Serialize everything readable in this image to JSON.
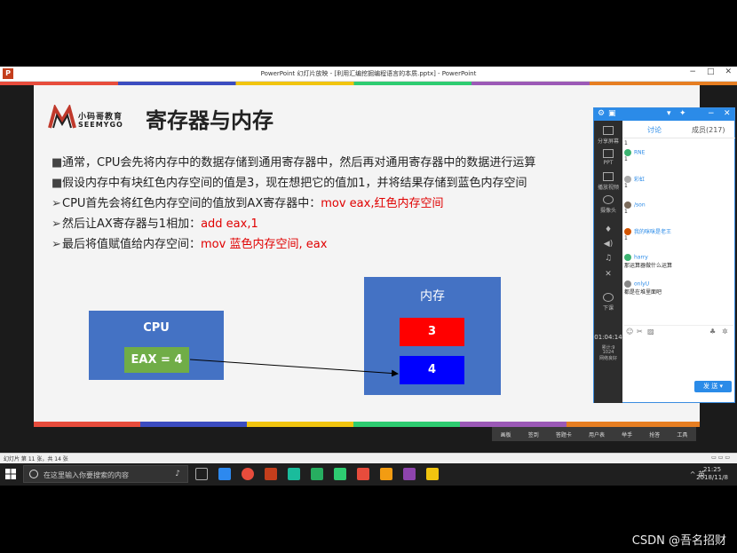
{
  "window": {
    "title": "PowerPoint 幻灯片放映 - [利用汇编挖掘编程语言的本质.pptx] - PowerPoint",
    "app_icon": "P",
    "controls": [
      "−",
      "□",
      "✕"
    ]
  },
  "slide": {
    "logo_cn": "小码哥教育",
    "logo_en": "SEEMYGO",
    "title": "寄存器与内存",
    "bullets": [
      {
        "marker": "■",
        "text": "通常，CPU会先将内存中的数据存储到通用寄存器中，然后再对通用寄存器中的数据进行运算",
        "red": ""
      },
      {
        "marker": "■",
        "text": "假设内存中有块红色内存空间的值是3，现在想把它的值加1，并将结果存储到蓝色内存空间",
        "red": ""
      },
      {
        "marker": "➢",
        "text": "CPU首先会将红色内存空间的值放到AX寄存器中：",
        "red": "mov eax,红色内存空间"
      },
      {
        "marker": "➢",
        "text": "然后让AX寄存器与1相加：",
        "red": "add eax,1"
      },
      {
        "marker": "➢",
        "text": "最后将值赋值给内存空间：",
        "red": "mov 蓝色内存空间, eax"
      }
    ],
    "cpu_label": "CPU",
    "register_label": "EAX = 4",
    "memory_label": "内存",
    "red_cell_value": "3",
    "blue_cell_value": "4",
    "colors": {
      "blue_box": "#4472c4",
      "green_reg": "#70ad47",
      "red_cell": "#ff0000",
      "blue_cell": "#0000ff"
    }
  },
  "chat_panel": {
    "tab_discuss": "讨论",
    "tab_members": "成员(217)",
    "side_items": [
      "分享屏幕",
      "PPT",
      "播放视频",
      "摄像头",
      "下课"
    ],
    "timer": "01:04:14",
    "timer_sub1": "累计:9",
    "timer_sub2": "1024",
    "timer_sub3": "网络良好",
    "messages": [
      {
        "name": "",
        "text": "1"
      },
      {
        "name": "RNE",
        "text": "1"
      },
      {
        "name": "彩虹",
        "text": "1"
      },
      {
        "name": "/son",
        "text": "1"
      },
      {
        "name": "我的咪咪是老王",
        "text": "1"
      },
      {
        "name": "harry",
        "text": "那运算器做什么运算"
      },
      {
        "name": "onlyU",
        "text": "都是在堆里面吧"
      }
    ],
    "send_label": "发 送"
  },
  "slideshow_tools": [
    "画板",
    "签到",
    "答题卡",
    "用户表",
    "举手",
    "抢答",
    "工具"
  ],
  "statusbar": {
    "left": "幻灯片 第 11 张，共 14 张",
    "zoom_icons": "▭ ▭ ▭"
  },
  "taskbar": {
    "search_placeholder": "在这里输入你要搜索的内容",
    "tray_text": "^ 英",
    "time": "21:25",
    "date": "2018/11/8"
  },
  "watermark": "CSDN @吾名招财"
}
